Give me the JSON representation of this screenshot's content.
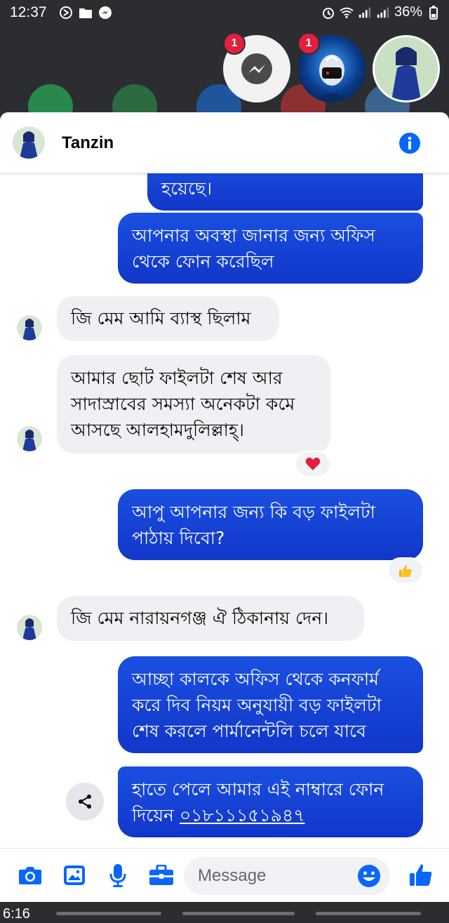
{
  "status_bar": {
    "time": "12:37",
    "battery": "36%"
  },
  "chat_heads": {
    "messenger_badge": "1",
    "game_badge": "1"
  },
  "header": {
    "contact_name": "Tanzin"
  },
  "messages": [
    {
      "id": "m1",
      "direction": "out",
      "text": "হয়েছে।"
    },
    {
      "id": "m2",
      "direction": "out",
      "lines": [
        "আপনার অবস্থা জানার জন্য অফিস",
        "থেকে ফোন করেছিল"
      ]
    },
    {
      "id": "m3",
      "direction": "in",
      "text": "জি মেম আমি ব্যাস্থ ছিলাম"
    },
    {
      "id": "m4",
      "direction": "in",
      "lines": [
        "আমার ছোট ফাইলটা শেষ আর",
        "সাদাস্রাবের সমস্যা অনেকটা কমে",
        "আসছে আলহামদুলিল্লাহ্।"
      ],
      "reaction": "heart"
    },
    {
      "id": "m5",
      "direction": "out",
      "lines": [
        "আপু আপনার জন্য কি বড় ফাইলটা",
        "পাঠায় দিবো?"
      ],
      "reaction": "thumbs-up"
    },
    {
      "id": "m6",
      "direction": "in",
      "text": "জি মেম নারায়নগঞ্জ ঐ ঠিকানায় দেন।"
    },
    {
      "id": "m7",
      "direction": "out",
      "lines": [
        "আচ্ছা কালকে অফিস থেকে কনফার্ম",
        "করে দিব নিয়ম অনুযায়ী বড় ফাইলটা",
        "শেষ করলে পার্মানেন্টলি চলে যাবে"
      ]
    },
    {
      "id": "m8",
      "direction": "out",
      "line1": "হাতে পেলে আমার এই নাম্বারে ফোন",
      "line2_prefix": "দিয়েন ",
      "phone": "০১৮১১১৫১৯৪৭"
    }
  ],
  "composer": {
    "placeholder": "Message"
  },
  "nav": {
    "time": "6:16"
  },
  "colors": {
    "outgoing_bubble": "#1a4fe0",
    "incoming_bubble": "#f0f0f4",
    "accent": "#0866ff"
  }
}
